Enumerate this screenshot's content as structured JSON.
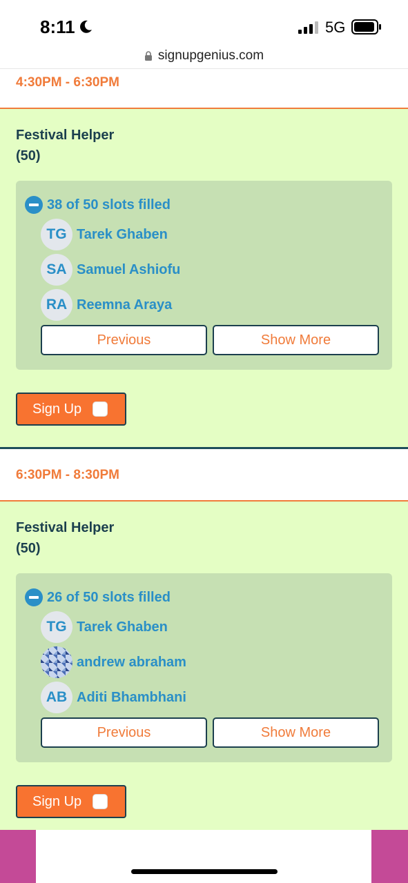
{
  "status_bar": {
    "time": "8:11",
    "network": "5G",
    "url": "signupgenius.com"
  },
  "slots": [
    {
      "time_range": "4:30PM - 6:30PM",
      "title": "Festival Helper",
      "capacity": "(50)",
      "filled_text": "38 of 50 slots filled",
      "people": [
        {
          "initials": "TG",
          "name": "Tarek Ghaben"
        },
        {
          "initials": "SA",
          "name": "Samuel Ashiofu"
        },
        {
          "initials": "RA",
          "name": "Reemna Araya"
        }
      ],
      "previous_label": "Previous",
      "show_more_label": "Show More",
      "signup_label": "Sign Up"
    },
    {
      "time_range": "6:30PM - 8:30PM",
      "title": "Festival Helper",
      "capacity": "(50)",
      "filled_text": "26 of 50 slots filled",
      "people": [
        {
          "initials": "TG",
          "name": "Tarek Ghaben"
        },
        {
          "initials": "",
          "name": "andrew abraham"
        },
        {
          "initials": "AB",
          "name": "Aditi Bhambhani"
        }
      ],
      "previous_label": "Previous",
      "show_more_label": "Show More",
      "signup_label": "Sign Up"
    }
  ],
  "colors": {
    "accent_orange": "#f07b3a",
    "slot_bg": "#e4fec4",
    "filled_bg": "#c6e0b3",
    "link_blue": "#2a8fc7",
    "dark_teal": "#1b3f4e",
    "footer_magenta": "#c44a97"
  }
}
